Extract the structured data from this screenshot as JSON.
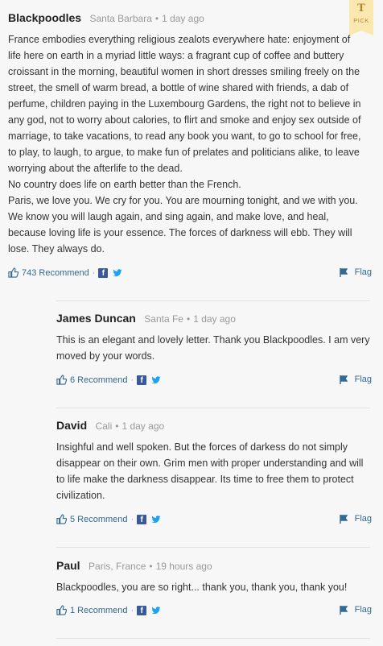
{
  "badge": {
    "label": "PICK",
    "logo": "T"
  },
  "comments": [
    {
      "author": "Blackpoodles",
      "location": "Santa Barbara",
      "time": "1 day ago",
      "paragraphs": [
        "France embodies everything religious zealots everywhere hate: enjoyment of life here on earth in a myriad little ways: a fragrant cup of coffee and buttery croissant in the morning, beautiful women in short dresses smiling freely on the street, the smell of warm bread, a bottle of wine shared with friends, a dab of perfume, children paying in the Luxembourg Gardens, the right not to believe in any god, not to worry about calories, to flirt and smoke and enjoy sex outside of marriage, to take vacations, to read any book you want, to go to school for free, to play, to laugh, to argue, to make fun of prelates and politicians alike, to leave worrying about the afterlife to the dead.",
        "No country does life on earth better than the French.",
        "Paris, we love you. We cry for you. You are mourning tonight, and we with you. We know you will laugh again, and sing again, and make love, and heal, because loving life is your essence. The forces of darkness will ebb. They will lose. They always do."
      ],
      "recommend": "743 Recommend",
      "flag": "Flag"
    },
    {
      "author": "James Duncan",
      "location": "Santa Fe",
      "time": "1 day ago",
      "paragraphs": [
        "This is an elegant and lovely letter. Thank you Blackpoodles. I am very moved by your words."
      ],
      "recommend": "6 Recommend",
      "flag": "Flag"
    },
    {
      "author": "David",
      "location": "Cali",
      "time": "1 day ago",
      "paragraphs": [
        "Insighful and well spoken. But the forces of darkess do not simply disappear on their own. Grim men with proper understanding and will to life make the darkness disappear. Its time to free them to protect civilization."
      ],
      "recommend": "5 Recommend",
      "flag": "Flag"
    },
    {
      "author": "Paul",
      "location": "Paris, France",
      "time": "19 hours ago",
      "paragraphs": [
        "Blackpoodles, you are so right... thank you, thank you, thank you!"
      ],
      "recommend": "1 Recommend",
      "flag": "Flag"
    }
  ],
  "share": {
    "facebook": "f"
  },
  "colors": {
    "link": "#326891",
    "facebook": "#3b5998",
    "twitter": "#1da1f2",
    "pick": "#fbe8b0"
  }
}
